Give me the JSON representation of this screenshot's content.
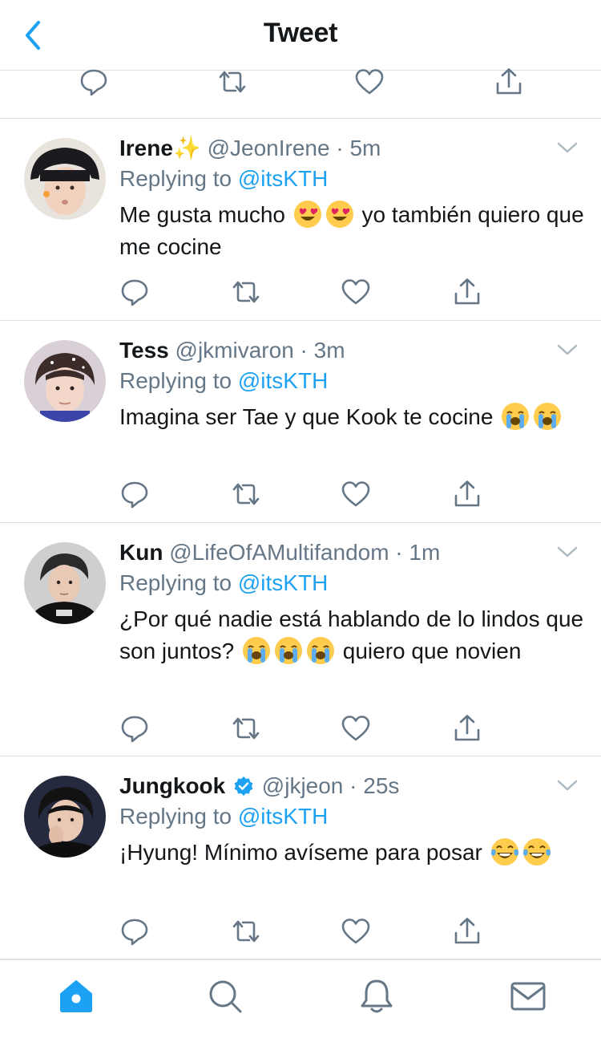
{
  "nav": {
    "title": "Tweet",
    "back_icon": "chevron-left-icon"
  },
  "colors": {
    "accent": "#1da1f2",
    "secondary_text": "#657786",
    "primary_text": "#14171a",
    "divider": "#dfe3e6",
    "verified": "#1da1f2"
  },
  "top_actions": [
    "reply-icon",
    "retweet-icon",
    "like-icon",
    "share-icon"
  ],
  "tweets": [
    {
      "name": "Irene",
      "name_emoji": "✨",
      "handle": "@JeonIrene",
      "time": "5m",
      "replying_prefix": "Replying to",
      "replying_to": "@itsKTH",
      "text_parts": [
        "Me gusta mucho ",
        " yo también quiero que me cocine"
      ],
      "emojis": [
        "heart-eyes-emoji",
        "heart-eyes-emoji"
      ]
    },
    {
      "name": "Tess",
      "handle": "@jkmivaron",
      "time": "3m",
      "replying_prefix": "Replying to",
      "replying_to": "@itsKTH",
      "text_parts": [
        "Imagina ser Tae y que Kook te cocine "
      ],
      "emojis": [
        "crying-emoji",
        "crying-emoji"
      ]
    },
    {
      "name": "Kun",
      "handle": "@LifeOfAMultifandom",
      "time": "1m",
      "replying_prefix": "Replying to",
      "replying_to": "@itsKTH",
      "text_parts": [
        "¿Por qué nadie está hablando de lo lindos que son juntos? ",
        " quiero que novien"
      ],
      "emojis": [
        "crying-emoji",
        "crying-emoji",
        "crying-emoji"
      ]
    },
    {
      "name": "Jungkook",
      "verified": true,
      "handle": "@jkjeon",
      "time": "25s",
      "replying_prefix": "Replying to",
      "replying_to": "@itsKTH",
      "text_parts": [
        "¡Hyung! Mínimo avíseme para posar "
      ],
      "emojis": [
        "tears-of-joy-emoji",
        "tears-of-joy-emoji"
      ]
    }
  ],
  "tabbar": [
    "home-icon",
    "search-icon",
    "notifications-icon",
    "messages-icon"
  ],
  "active_tab": "home-icon"
}
